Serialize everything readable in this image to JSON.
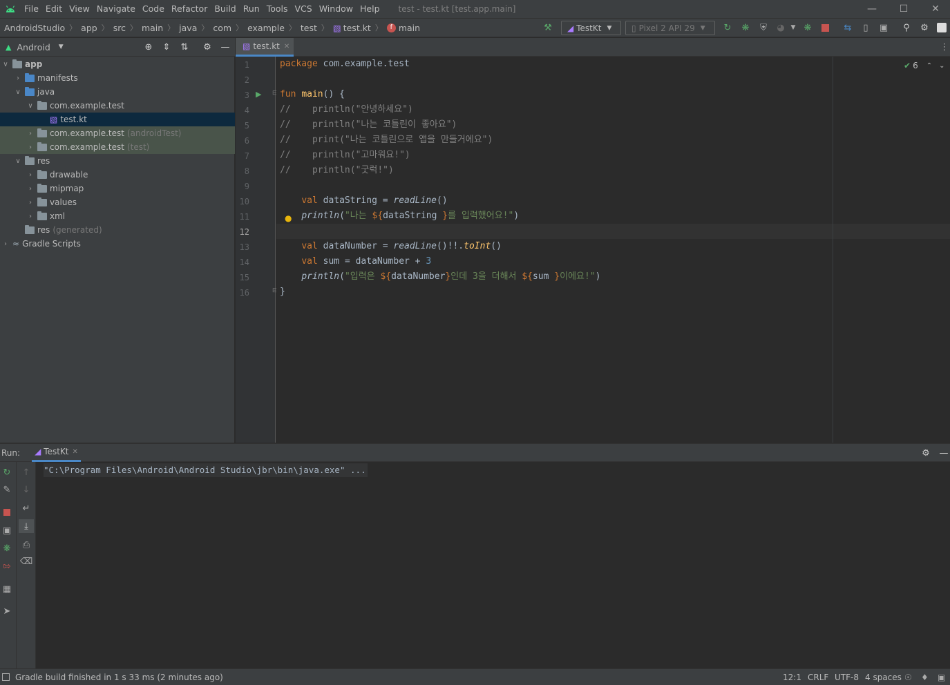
{
  "menu": {
    "items": [
      "File",
      "Edit",
      "View",
      "Navigate",
      "Code",
      "Refactor",
      "Build",
      "Run",
      "Tools",
      "VCS",
      "Window",
      "Help"
    ],
    "window_title": "test - test.kt [test.app.main]"
  },
  "breadcrumbs": [
    "AndroidStudio",
    "app",
    "src",
    "main",
    "java",
    "com",
    "example",
    "test",
    "test.kt",
    "main"
  ],
  "toolbar": {
    "run_config": "TestKt",
    "device": "Pixel 2 API 29"
  },
  "project": {
    "view_selector": "Android",
    "tree": [
      {
        "label": "app",
        "depth": 0,
        "arrow": "v",
        "icon": "module"
      },
      {
        "label": "manifests",
        "depth": 1,
        "arrow": ">",
        "icon": "folder-blue"
      },
      {
        "label": "java",
        "depth": 1,
        "arrow": "v",
        "icon": "folder-blue"
      },
      {
        "label": "com.example.test",
        "depth": 2,
        "arrow": "v",
        "icon": "package"
      },
      {
        "label": "test.kt",
        "depth": 3,
        "arrow": "",
        "icon": "kotlin-file",
        "selected": true
      },
      {
        "label": "com.example.test",
        "suffix": "(androidTest)",
        "depth": 2,
        "arrow": ">",
        "icon": "package",
        "test": true
      },
      {
        "label": "com.example.test",
        "suffix": "(test)",
        "depth": 2,
        "arrow": ">",
        "icon": "package",
        "test": true
      },
      {
        "label": "res",
        "depth": 1,
        "arrow": "v",
        "icon": "folder-res"
      },
      {
        "label": "drawable",
        "depth": 2,
        "arrow": ">",
        "icon": "folder"
      },
      {
        "label": "mipmap",
        "depth": 2,
        "arrow": ">",
        "icon": "folder"
      },
      {
        "label": "values",
        "depth": 2,
        "arrow": ">",
        "icon": "folder"
      },
      {
        "label": "xml",
        "depth": 2,
        "arrow": ">",
        "icon": "folder"
      },
      {
        "label": "res",
        "suffix": "(generated)",
        "depth": 1,
        "arrow": "",
        "icon": "folder-res"
      },
      {
        "label": "Gradle Scripts",
        "depth": 0,
        "arrow": ">",
        "icon": "gradle"
      }
    ]
  },
  "editor": {
    "tab_label": "test.kt",
    "inspection_count": "6",
    "current_line": 12,
    "lines": [
      [
        [
          "kw",
          "package "
        ],
        [
          "p",
          "com.example.test"
        ]
      ],
      [],
      [
        [
          "kw",
          "fun "
        ],
        [
          "fn",
          "main"
        ],
        [
          "p",
          "() {"
        ]
      ],
      [
        [
          "cm",
          "//    println(\"안녕하세요\")"
        ]
      ],
      [
        [
          "cm",
          "//    println(\"나는 코틀린이 좋아요\")"
        ]
      ],
      [
        [
          "cm",
          "//    print(\"나는 코틀린으로 앱을 만들거에요\")"
        ]
      ],
      [
        [
          "cm",
          "//    println(\"고마워요!\")"
        ]
      ],
      [
        [
          "cm",
          "//    println(\"굿럭!\")"
        ]
      ],
      [],
      [
        [
          "p",
          "    "
        ],
        [
          "kw",
          "val "
        ],
        [
          "p",
          "dataString = "
        ],
        [
          "it",
          "readLine"
        ],
        [
          "p",
          "()"
        ]
      ],
      [
        [
          "p",
          "    "
        ],
        [
          "it",
          "println"
        ],
        [
          "p",
          "("
        ],
        [
          "str",
          "\"나는 "
        ],
        [
          "tpl",
          "${"
        ],
        [
          "p",
          "dataString "
        ],
        [
          "tpl",
          "}"
        ],
        [
          "str",
          "를 입력했어요!\""
        ],
        [
          "p",
          ")"
        ]
      ],
      [],
      [
        [
          "p",
          "    "
        ],
        [
          "kw",
          "val "
        ],
        [
          "p",
          "dataNumber = "
        ],
        [
          "it",
          "readLine"
        ],
        [
          "p",
          "()!!."
        ],
        [
          "itfn",
          "toInt"
        ],
        [
          "p",
          "()"
        ]
      ],
      [
        [
          "p",
          "    "
        ],
        [
          "kw",
          "val "
        ],
        [
          "p",
          "sum = dataNumber + "
        ],
        [
          "num",
          "3"
        ]
      ],
      [
        [
          "p",
          "    "
        ],
        [
          "it",
          "println"
        ],
        [
          "p",
          "("
        ],
        [
          "str",
          "\"입력은 "
        ],
        [
          "tpl",
          "${"
        ],
        [
          "p",
          "dataNumber"
        ],
        [
          "tpl",
          "}"
        ],
        [
          "str",
          "인데 3을 더해서 "
        ],
        [
          "tpl",
          "${"
        ],
        [
          "p",
          "sum "
        ],
        [
          "tpl",
          "}"
        ],
        [
          "str",
          "이에요!\""
        ],
        [
          "p",
          ")"
        ]
      ],
      [
        [
          "p",
          "}"
        ]
      ]
    ]
  },
  "run": {
    "label": "Run:",
    "tab_label": "TestKt",
    "console_output": "\"C:\\Program Files\\Android\\Android Studio\\jbr\\bin\\java.exe\" ..."
  },
  "status": {
    "message": "Gradle build finished in 1 s 33 ms (2 minutes ago)",
    "position": "12:1",
    "line_sep": "CRLF",
    "encoding": "UTF-8",
    "indent": "4 spaces"
  }
}
